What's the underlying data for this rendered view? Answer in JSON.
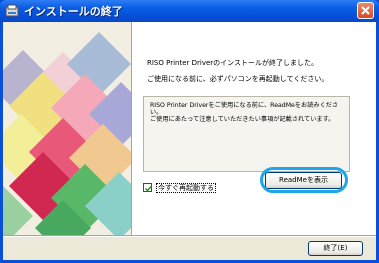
{
  "window": {
    "title": "インストールの終了",
    "accent": "#0a50d6"
  },
  "content": {
    "line1": "RISO Printer Driverのインストールが終了しました。",
    "line2": "ご使用になる前に、必ずパソコンを再起動してください。",
    "group_text": "RISO Printer Driverをご使用になる前に、ReadMeをお読みください。\nご使用にあたって注意していただきたい事項が記載されています。",
    "readme_button": "ReadMeを表示",
    "highlight_color": "#1aa8e8"
  },
  "restart": {
    "label": "今すぐ再起動する",
    "checked": true
  },
  "footer": {
    "exit_button": "終了(E)"
  }
}
